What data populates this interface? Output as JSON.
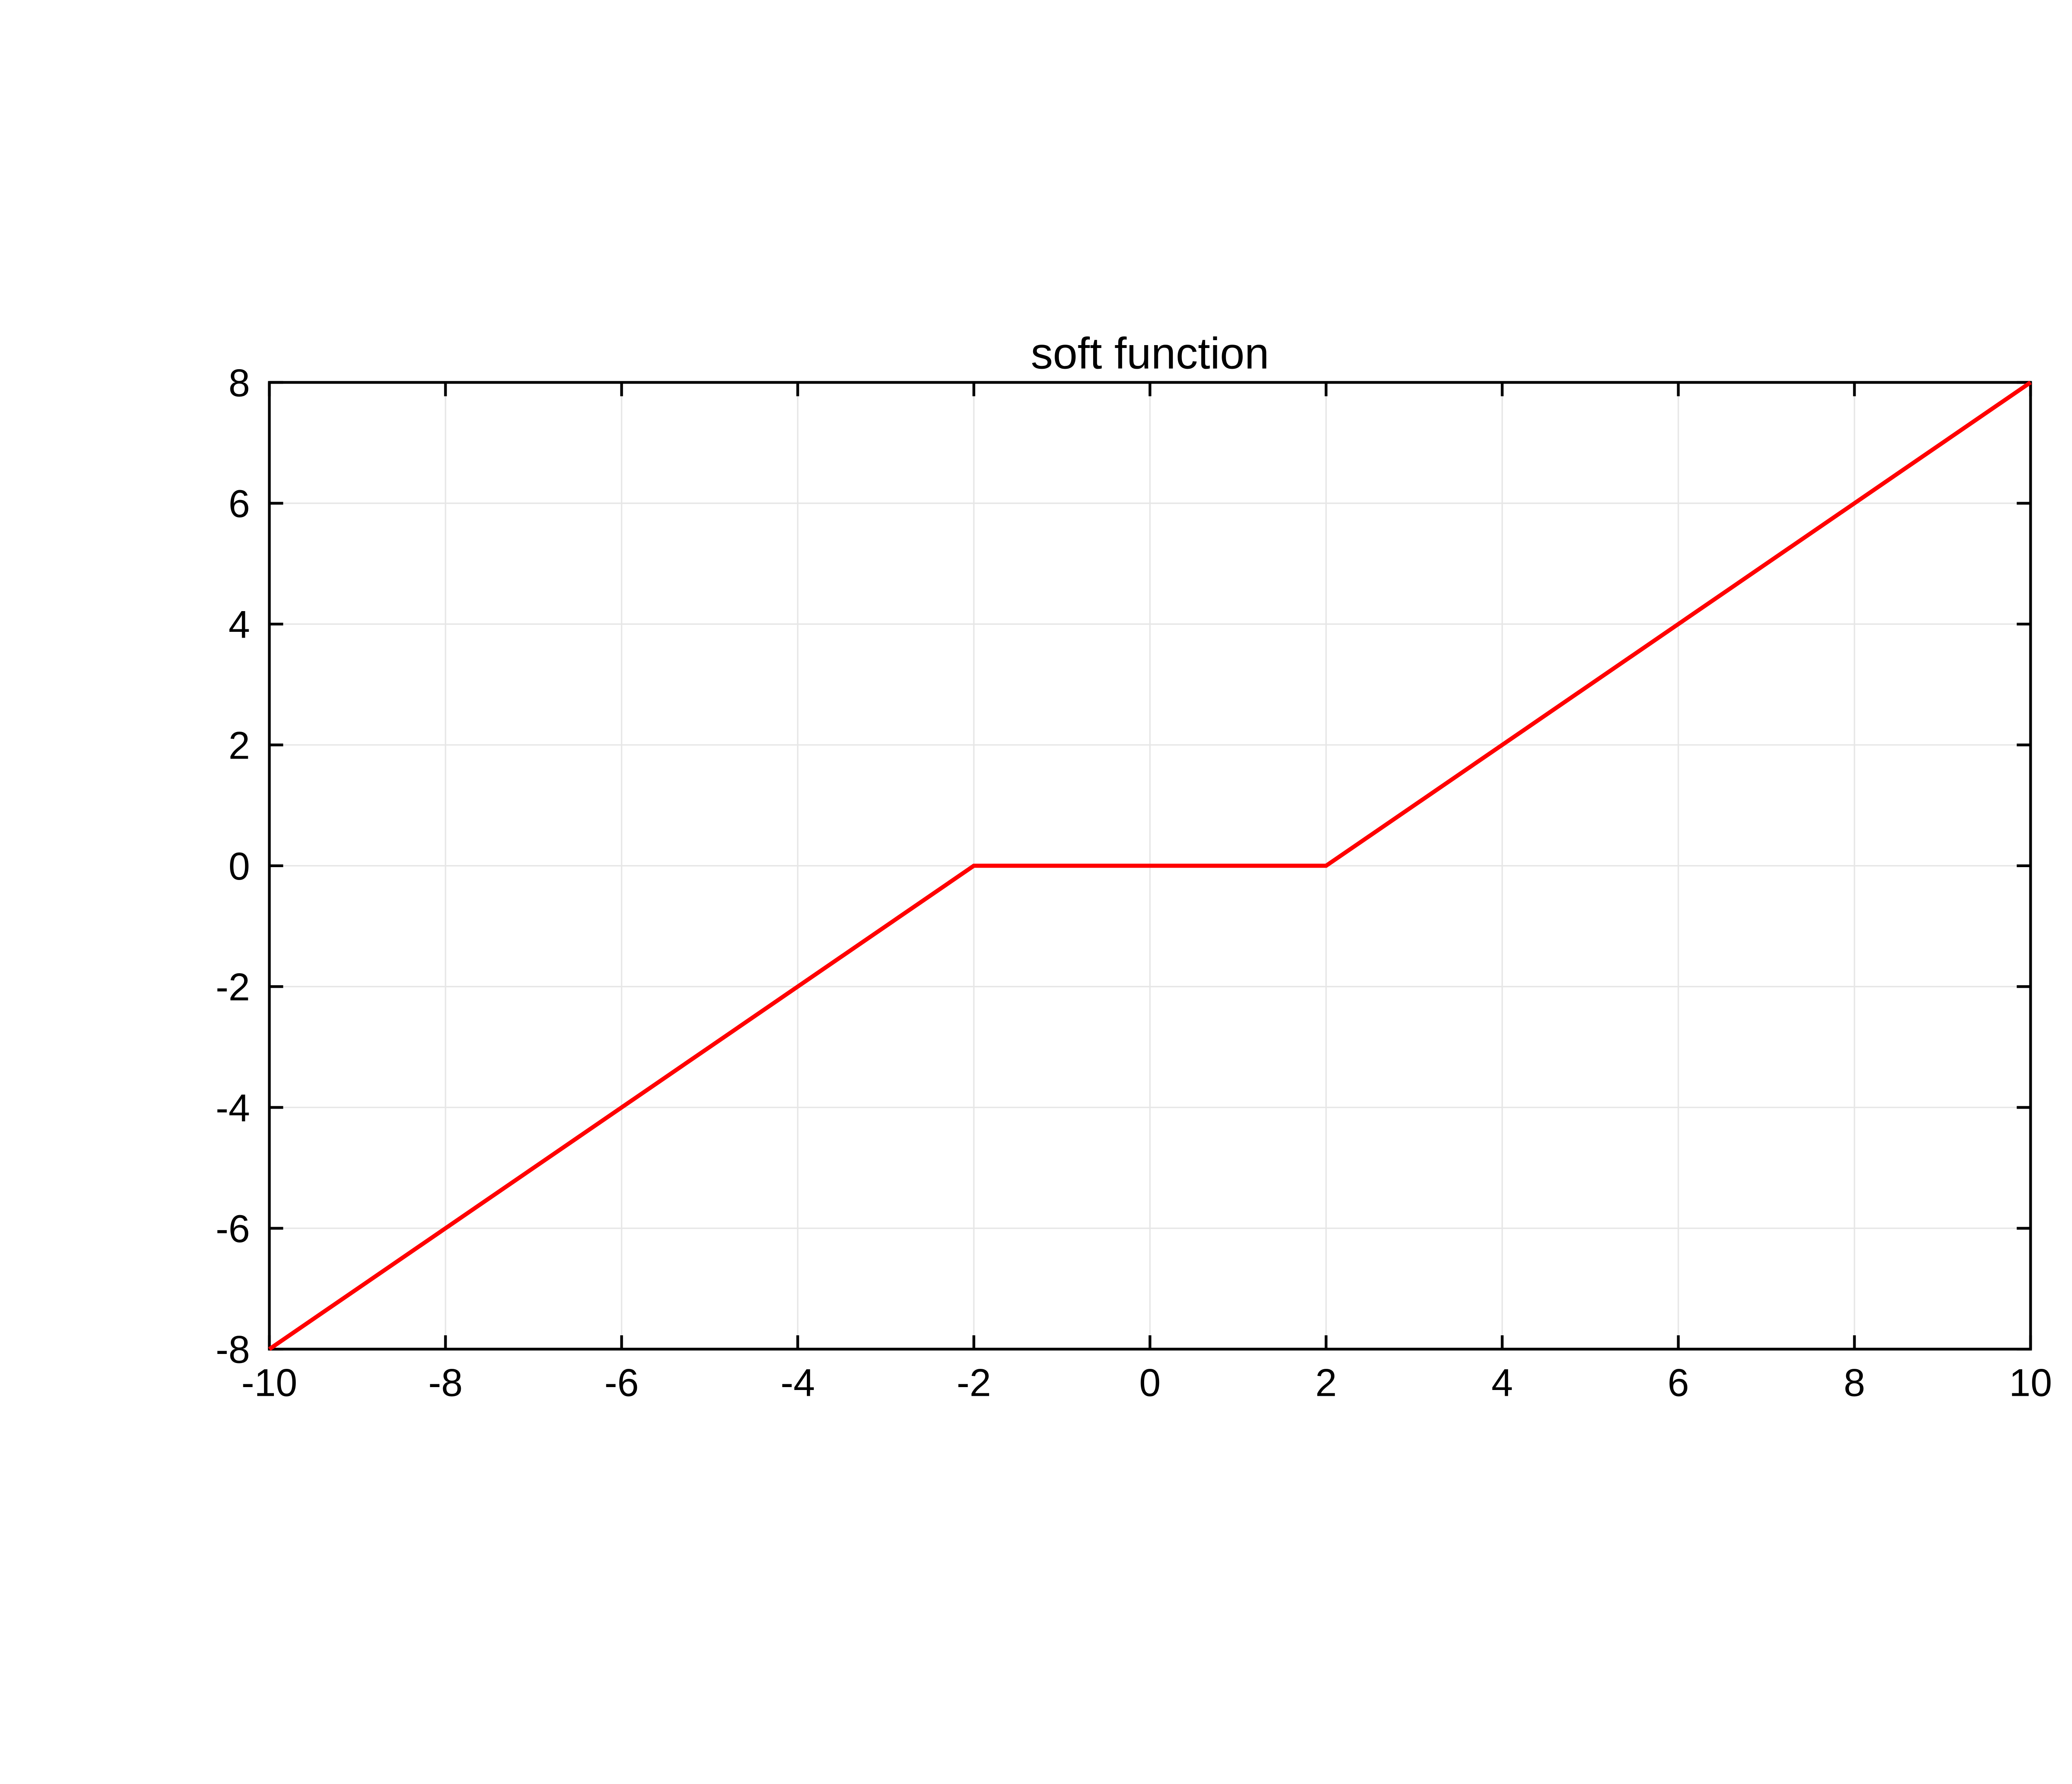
{
  "chart_data": {
    "type": "line",
    "title": "soft function",
    "xlabel": "",
    "ylabel": "",
    "xlim": [
      -10,
      10
    ],
    "ylim": [
      -8,
      8
    ],
    "xticks": [
      -10,
      -8,
      -6,
      -4,
      -2,
      0,
      2,
      4,
      6,
      8,
      10
    ],
    "yticks": [
      -8,
      -6,
      -4,
      -2,
      0,
      2,
      4,
      6,
      8
    ],
    "series": [
      {
        "name": "soft",
        "color": "#ff0000",
        "x": [
          -10,
          -2,
          2,
          10
        ],
        "y": [
          -8,
          0,
          0,
          8
        ]
      }
    ],
    "grid": true
  }
}
